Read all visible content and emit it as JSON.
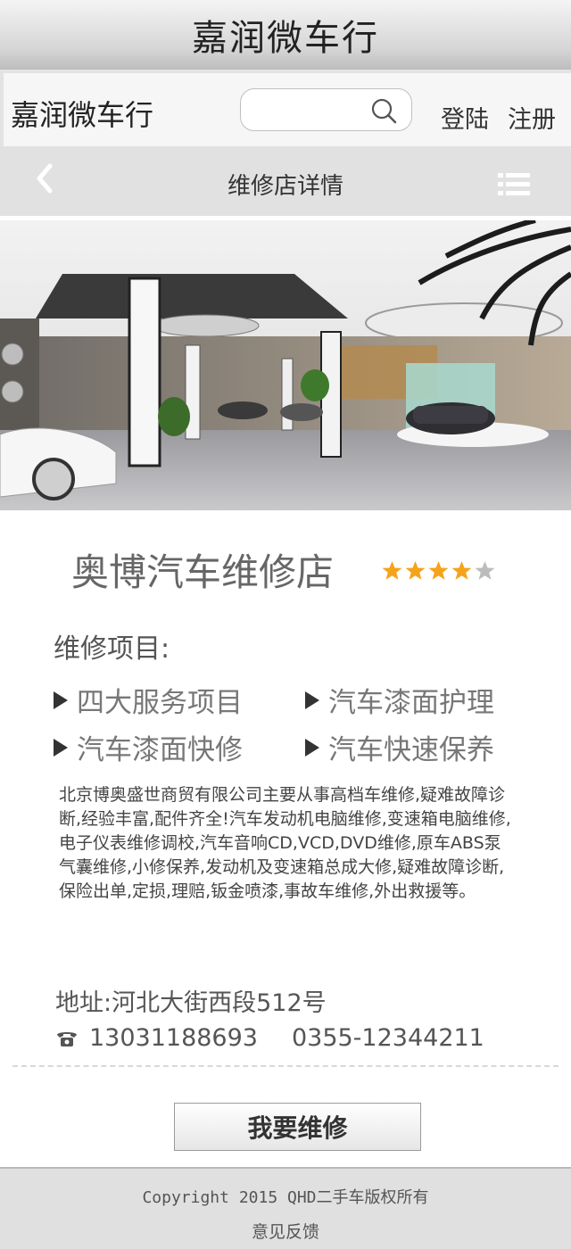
{
  "app": {
    "title": "嘉润微车行"
  },
  "topbar": {
    "brand": "嘉润微车行",
    "search_placeholder": "",
    "login": "登陆",
    "register": "注册"
  },
  "navbar": {
    "title": "维修店详情"
  },
  "icons": {
    "back": "chevron-left-icon",
    "menu": "list-menu-icon",
    "search": "search-icon",
    "phone": "phone-icon",
    "star": "star-icon"
  },
  "shop": {
    "name": "奥博汽车维修店",
    "rating": 4,
    "rating_max": 5,
    "star_color": "#f5a31a",
    "star_empty_color": "#bcbcbc"
  },
  "services": {
    "label": "维修项目:",
    "items": [
      "四大服务项目",
      "汽车漆面护理",
      "汽车漆面快修",
      "汽车快速保养"
    ]
  },
  "description": "北京博奥盛世商贸有限公司主要从事高档车维修,疑难故障诊断,经验丰富,配件齐全!汽车发动机电脑维修,变速箱电脑维修,电子仪表维修调校,汽车音响CD,VCD,DVD维修,原车ABS泵气囊维修,小修保养,发动机及变速箱总成大修,疑难故障诊断,保险出单,定损,理赔,钣金喷漆,事故车维修,外出救援等。",
  "contact": {
    "address": "地址:河北大街西段512号",
    "phone1": "13031188693",
    "phone2": "0355-12344211"
  },
  "actions": {
    "repair_button": "我要维修"
  },
  "footer": {
    "copyright": "Copyright  2015 QHD二手车版权所有",
    "feedback": "意见反馈"
  }
}
